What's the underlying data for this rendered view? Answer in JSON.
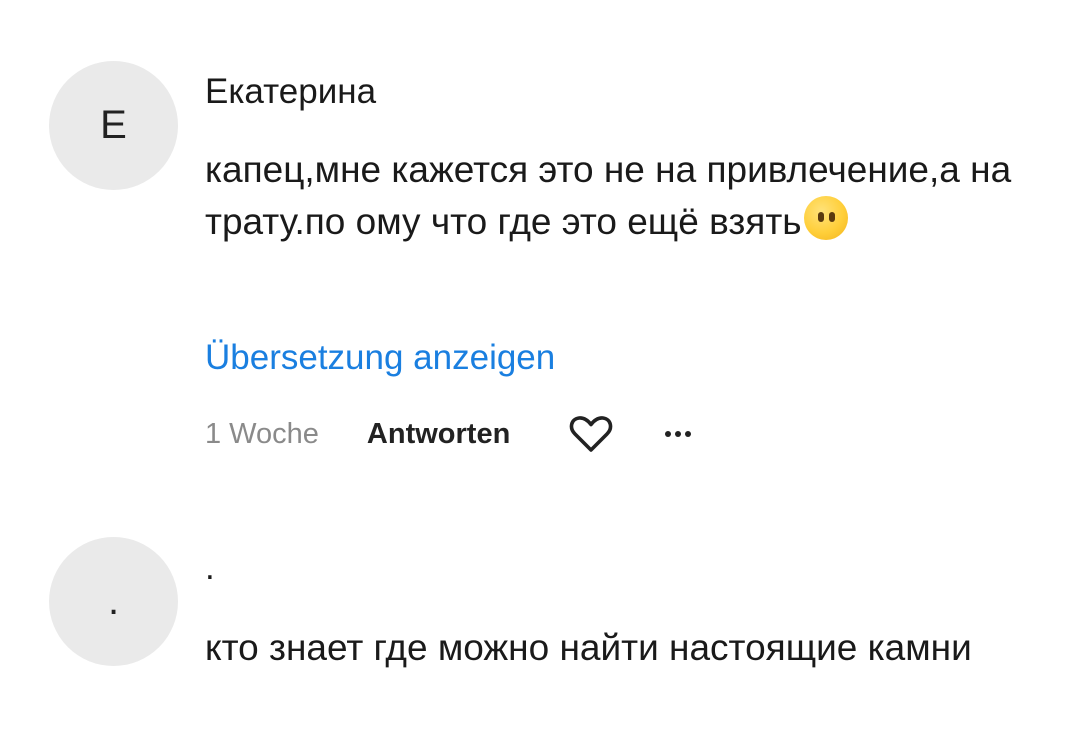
{
  "comments": [
    {
      "avatar_initial": "Е",
      "author": "Екатерина",
      "text": "капец,мне кажется это не на привлечение,а на трату.по ому что где это ещё взять",
      "emoji": "face-without-mouth-emoji",
      "translate_label": "Übersetzung anzeigen",
      "time": "1 Woche",
      "reply_label": "Antworten"
    },
    {
      "avatar_initial": ".",
      "author": ".",
      "text": "кто знает где можно найти настоящие камни"
    }
  ],
  "icons": {
    "like": "heart-outline-icon",
    "more": "more-options-icon"
  },
  "colors": {
    "link": "#1a7fe0",
    "muted": "#8a8a8a",
    "avatar_bg": "#eaeaea"
  }
}
